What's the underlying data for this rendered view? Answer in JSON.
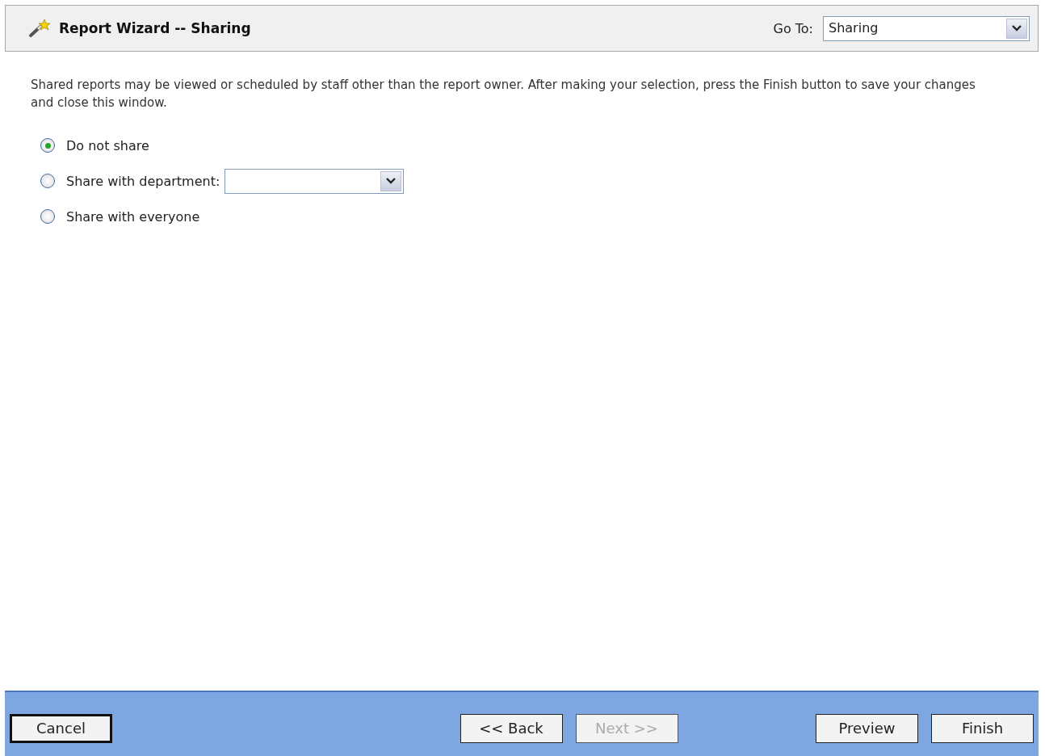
{
  "header": {
    "title": "Report Wizard -- Sharing",
    "goto_label": "Go To:",
    "goto_value": "Sharing"
  },
  "description": "Shared reports may be viewed or scheduled by staff other than the report owner. After making your selection, press the Finish button to save your changes and close this window.",
  "options": [
    {
      "label": "Do not share",
      "selected": true,
      "kind": "plain"
    },
    {
      "label": "Share with department:",
      "selected": false,
      "kind": "dropdown"
    },
    {
      "label": "Share with everyone",
      "selected": false,
      "kind": "plain"
    }
  ],
  "footer": {
    "left_buttons": [
      {
        "label": "Cancel",
        "disabled": false,
        "default": true
      }
    ],
    "center_buttons": [
      {
        "label": "<< Back",
        "disabled": false,
        "default": false
      },
      {
        "label": "Next >>",
        "disabled": true,
        "default": false
      }
    ],
    "right_buttons": [
      {
        "label": "Preview",
        "disabled": false,
        "default": false
      },
      {
        "label": "Finish",
        "disabled": false,
        "default": false
      }
    ]
  }
}
